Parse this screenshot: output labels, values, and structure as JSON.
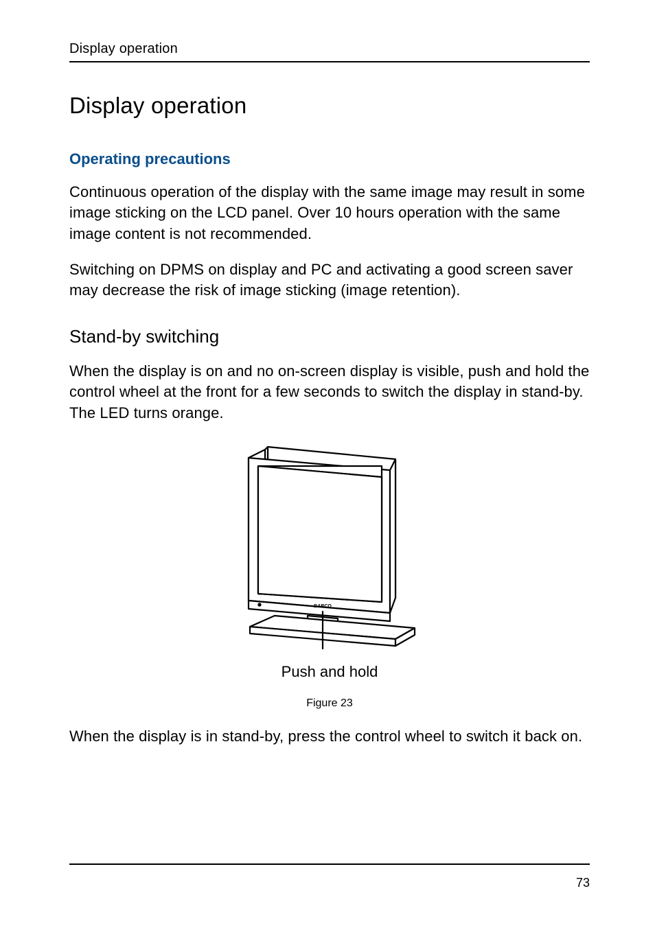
{
  "runningHead": "Display operation",
  "title": "Display operation",
  "section1": {
    "heading": "Operating precautions",
    "p1": "Continuous operation of the display with the same image may result in some image sticking on the LCD panel. Over 10 hours operation with the same image content is not recommended.",
    "p2": "Switching on DPMS on display and PC and activating a good screen saver may decrease the risk of image sticking (image retention)."
  },
  "section2": {
    "heading": "Stand-by switching",
    "p1": "When the display is on and no on-screen display is visible, push and hold the control wheel at the front for a few seconds to switch the display in stand-by. The LED turns orange.",
    "figure": {
      "label": "Push and hold",
      "caption": "Figure 23",
      "monitorBrand": "BARCO"
    },
    "p2": "When the display is in stand-by, press the control wheel to switch it back on."
  },
  "pageNumber": "73"
}
